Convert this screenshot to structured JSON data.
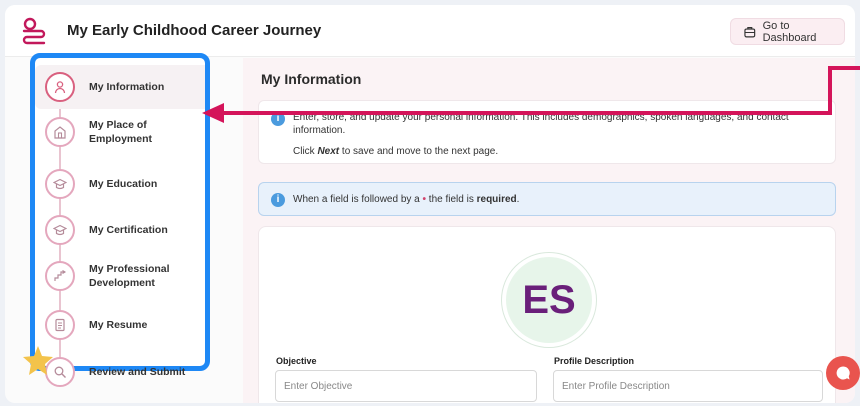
{
  "header": {
    "title": "My Early Childhood Career Journey",
    "dashboard_label": "Go to Dashboard"
  },
  "sidebar": {
    "steps": [
      {
        "label": "My Information",
        "icon": "person-icon",
        "active": true
      },
      {
        "label": "My Place of Employment",
        "icon": "building-icon",
        "active": false
      },
      {
        "label": "My Education",
        "icon": "graduation-cap-icon",
        "active": false
      },
      {
        "label": "My Certification",
        "icon": "graduation-cap-icon",
        "active": false
      },
      {
        "label": "My Professional Development",
        "icon": "growth-chart-icon",
        "active": false
      },
      {
        "label": "My Resume",
        "icon": "document-icon",
        "active": false
      },
      {
        "label": "Review and Submit",
        "icon": "search-icon",
        "active": false
      }
    ]
  },
  "main": {
    "title": "My Information",
    "info_text": "Enter, store, and update your personal information. This includes demographics, spoken languages, and contact information.",
    "next_word": "Next",
    "next_rest": " to save and move to the next page.",
    "next_prefix": "Click ",
    "required_prefix": "When a field is followed by a ",
    "required_mid": " the field is ",
    "required_word": "required",
    "required_suffix": "."
  },
  "form": {
    "avatar_initials": "ES",
    "objective_label": "Objective",
    "objective_placeholder": "Enter Objective",
    "profile_label": "Profile Description",
    "profile_placeholder": "Enter Profile Description"
  },
  "colors": {
    "accent": "#d9607f",
    "highlight_border": "#1e88f5",
    "arrow": "#d4145a",
    "chat": "#e9544e",
    "avatar_text": "#6a1f7a"
  }
}
